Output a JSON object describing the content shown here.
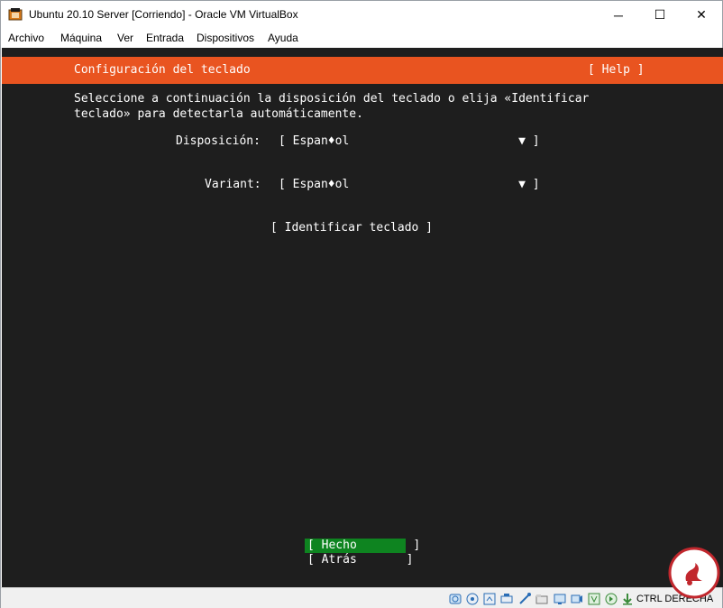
{
  "window": {
    "title": "Ubuntu 20.10 Server [Corriendo] - Oracle VM VirtualBox",
    "controls": {
      "minimize": "─",
      "maximize": "☐",
      "close": "✕"
    }
  },
  "menu": [
    "Archivo",
    "Máquina",
    "Ver",
    "Entrada",
    "Dispositivos",
    "Ayuda"
  ],
  "installer": {
    "header_title": "Configuración del teclado",
    "help_label": "[ Help ]",
    "instructions": "Seleccione a continuación la disposición del teclado o elija «Identificar\nteclado» para detectarla automáticamente.",
    "layout_label": "Disposición:",
    "layout_value": "[ Espan♦ol                        ▼ ]",
    "variant_label": "Variant:",
    "variant_value": "[ Espan♦ol                        ▼ ]",
    "identify_label": "[ Identificar teclado ]",
    "done_label": "[ Hecho        ]",
    "back_label": "[ Atrás       ]",
    "header_color": "#e95420",
    "done_color": "#0e8420"
  },
  "statusbar": {
    "host_key": "CTRL DERECHA",
    "icons": [
      "hard-disk-icon",
      "optical-drive-icon",
      "audio-icon",
      "network-icon",
      "usb-icon",
      "shared-folders-icon",
      "display-icon",
      "video-capture-icon",
      "virtualization-icon",
      "mouse-integration-icon",
      "download-icon"
    ]
  }
}
